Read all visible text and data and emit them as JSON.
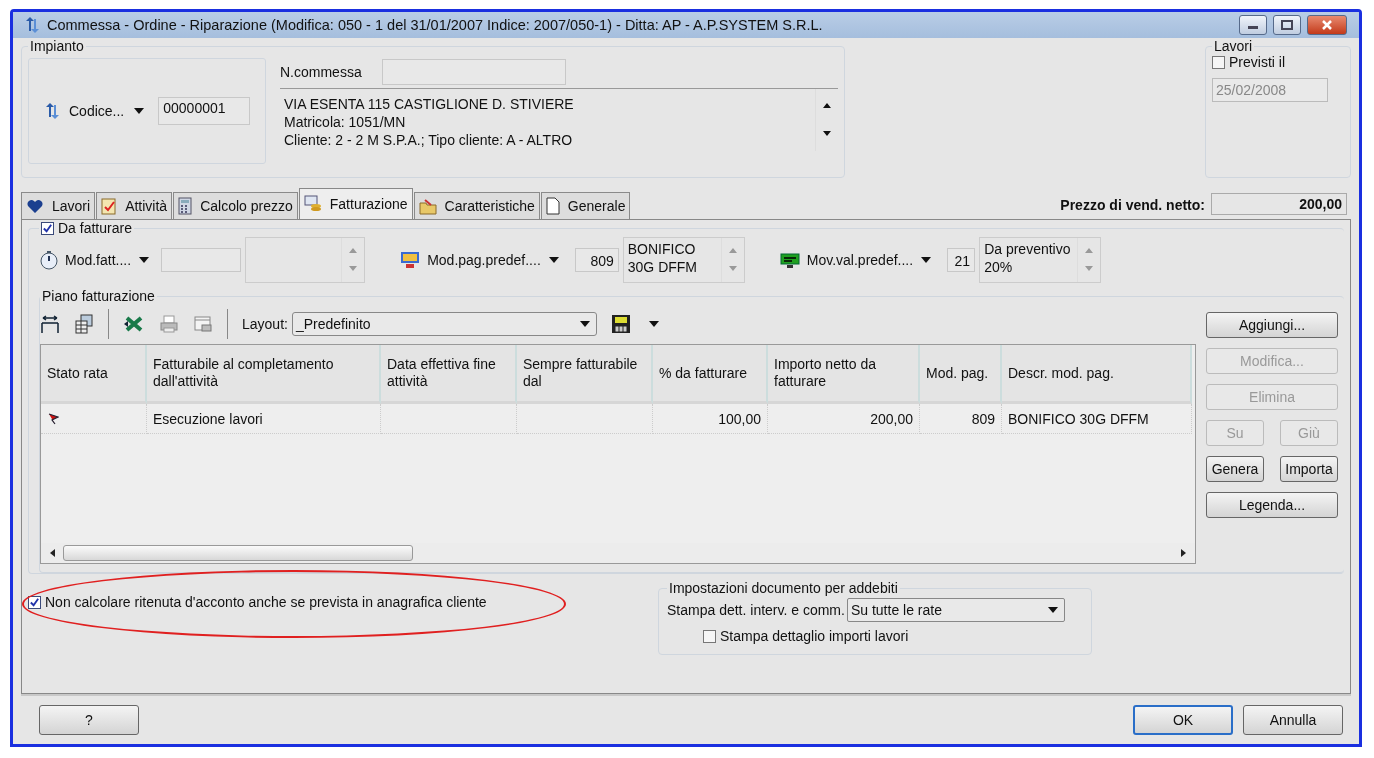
{
  "window": {
    "title": "Commessa - Ordine - Riparazione (Modifica:  050 - 1 del 31/01/2007 Indice: 2007/050-1) - Ditta: AP - A.P.SYSTEM S.R.L."
  },
  "impianto": {
    "label": "Impianto",
    "code_selector": "Codice...",
    "code_value": "00000001",
    "n_commessa_label": "N.commessa",
    "address_lines": [
      "VIA ESENTA 115 CASTIGLIONE D. STIVIERE",
      "Matricola: 1051/MN",
      "Cliente: 2 - 2 M S.P.A.; Tipo cliente: A - ALTRO"
    ]
  },
  "lavori": {
    "label": "Lavori",
    "previsti_label": "Previsti il",
    "previsti_checked": false,
    "date": "25/02/2008"
  },
  "tabs": [
    {
      "label": "Lavori",
      "selected": false
    },
    {
      "label": "Attività",
      "selected": false
    },
    {
      "label": "Calcolo prezzo",
      "selected": false
    },
    {
      "label": "Fatturazione",
      "selected": true
    },
    {
      "label": "Caratteristiche",
      "selected": false
    },
    {
      "label": "Generale",
      "selected": false
    }
  ],
  "prezzo": {
    "label": "Prezzo di vend. netto:",
    "value": "200,00"
  },
  "fatturazione": {
    "da_fatturare_label": "Da fatturare",
    "da_fatturare_checked": true,
    "mod_fatt": "Mod.fatt....",
    "mod_pag": {
      "label": "Mod.pag.predef....",
      "code": "809",
      "lines": [
        "BONIFICO",
        "30G DFFM"
      ]
    },
    "mov_val": {
      "label": "Mov.val.predef....",
      "code": "21",
      "lines": [
        "Da preventivo",
        "20%"
      ]
    }
  },
  "piano": {
    "label": "Piano fatturazione",
    "layout_label": "Layout:",
    "layout_value": "_Predefinito",
    "columns": [
      "Stato rata",
      "Fatturabile al completamento dall'attività",
      "Data effettiva fine attività",
      "Sempre fatturabile dal",
      "% da fatturare",
      "Importo netto da fatturare",
      "Mod. pag.",
      "Descr. mod. pag."
    ],
    "rows": [
      {
        "cells": [
          "",
          "Esecuzione lavori",
          "",
          "",
          "100,00",
          "200,00",
          "809",
          "BONIFICO 30G DFFM"
        ]
      }
    ],
    "buttons": [
      {
        "label": "Aggiungi...",
        "disabled": false
      },
      {
        "label": "Modifica...",
        "disabled": true
      },
      {
        "label": "Elimina",
        "disabled": true
      },
      {
        "label": "Su",
        "disabled": true
      },
      {
        "label": "Giù",
        "disabled": true
      },
      {
        "label": "Genera",
        "disabled": false
      },
      {
        "label": "Importa",
        "disabled": false
      },
      {
        "label": "Legenda...",
        "disabled": false
      }
    ]
  },
  "ritenuta": {
    "label": "Non calcolare ritenuta d'acconto anche se prevista in anagrafica cliente",
    "checked": true
  },
  "impostazioni": {
    "title": "Impostazioni documento per addebiti",
    "stampa_label": "Stampa dett. interv. e comm.",
    "stampa_value": "Su tutte le rate",
    "dettaglio_label": "Stampa dettaglio importi lavori",
    "dettaglio_checked": false
  },
  "footer": {
    "help": "?",
    "ok": "OK",
    "cancel": "Annulla"
  }
}
